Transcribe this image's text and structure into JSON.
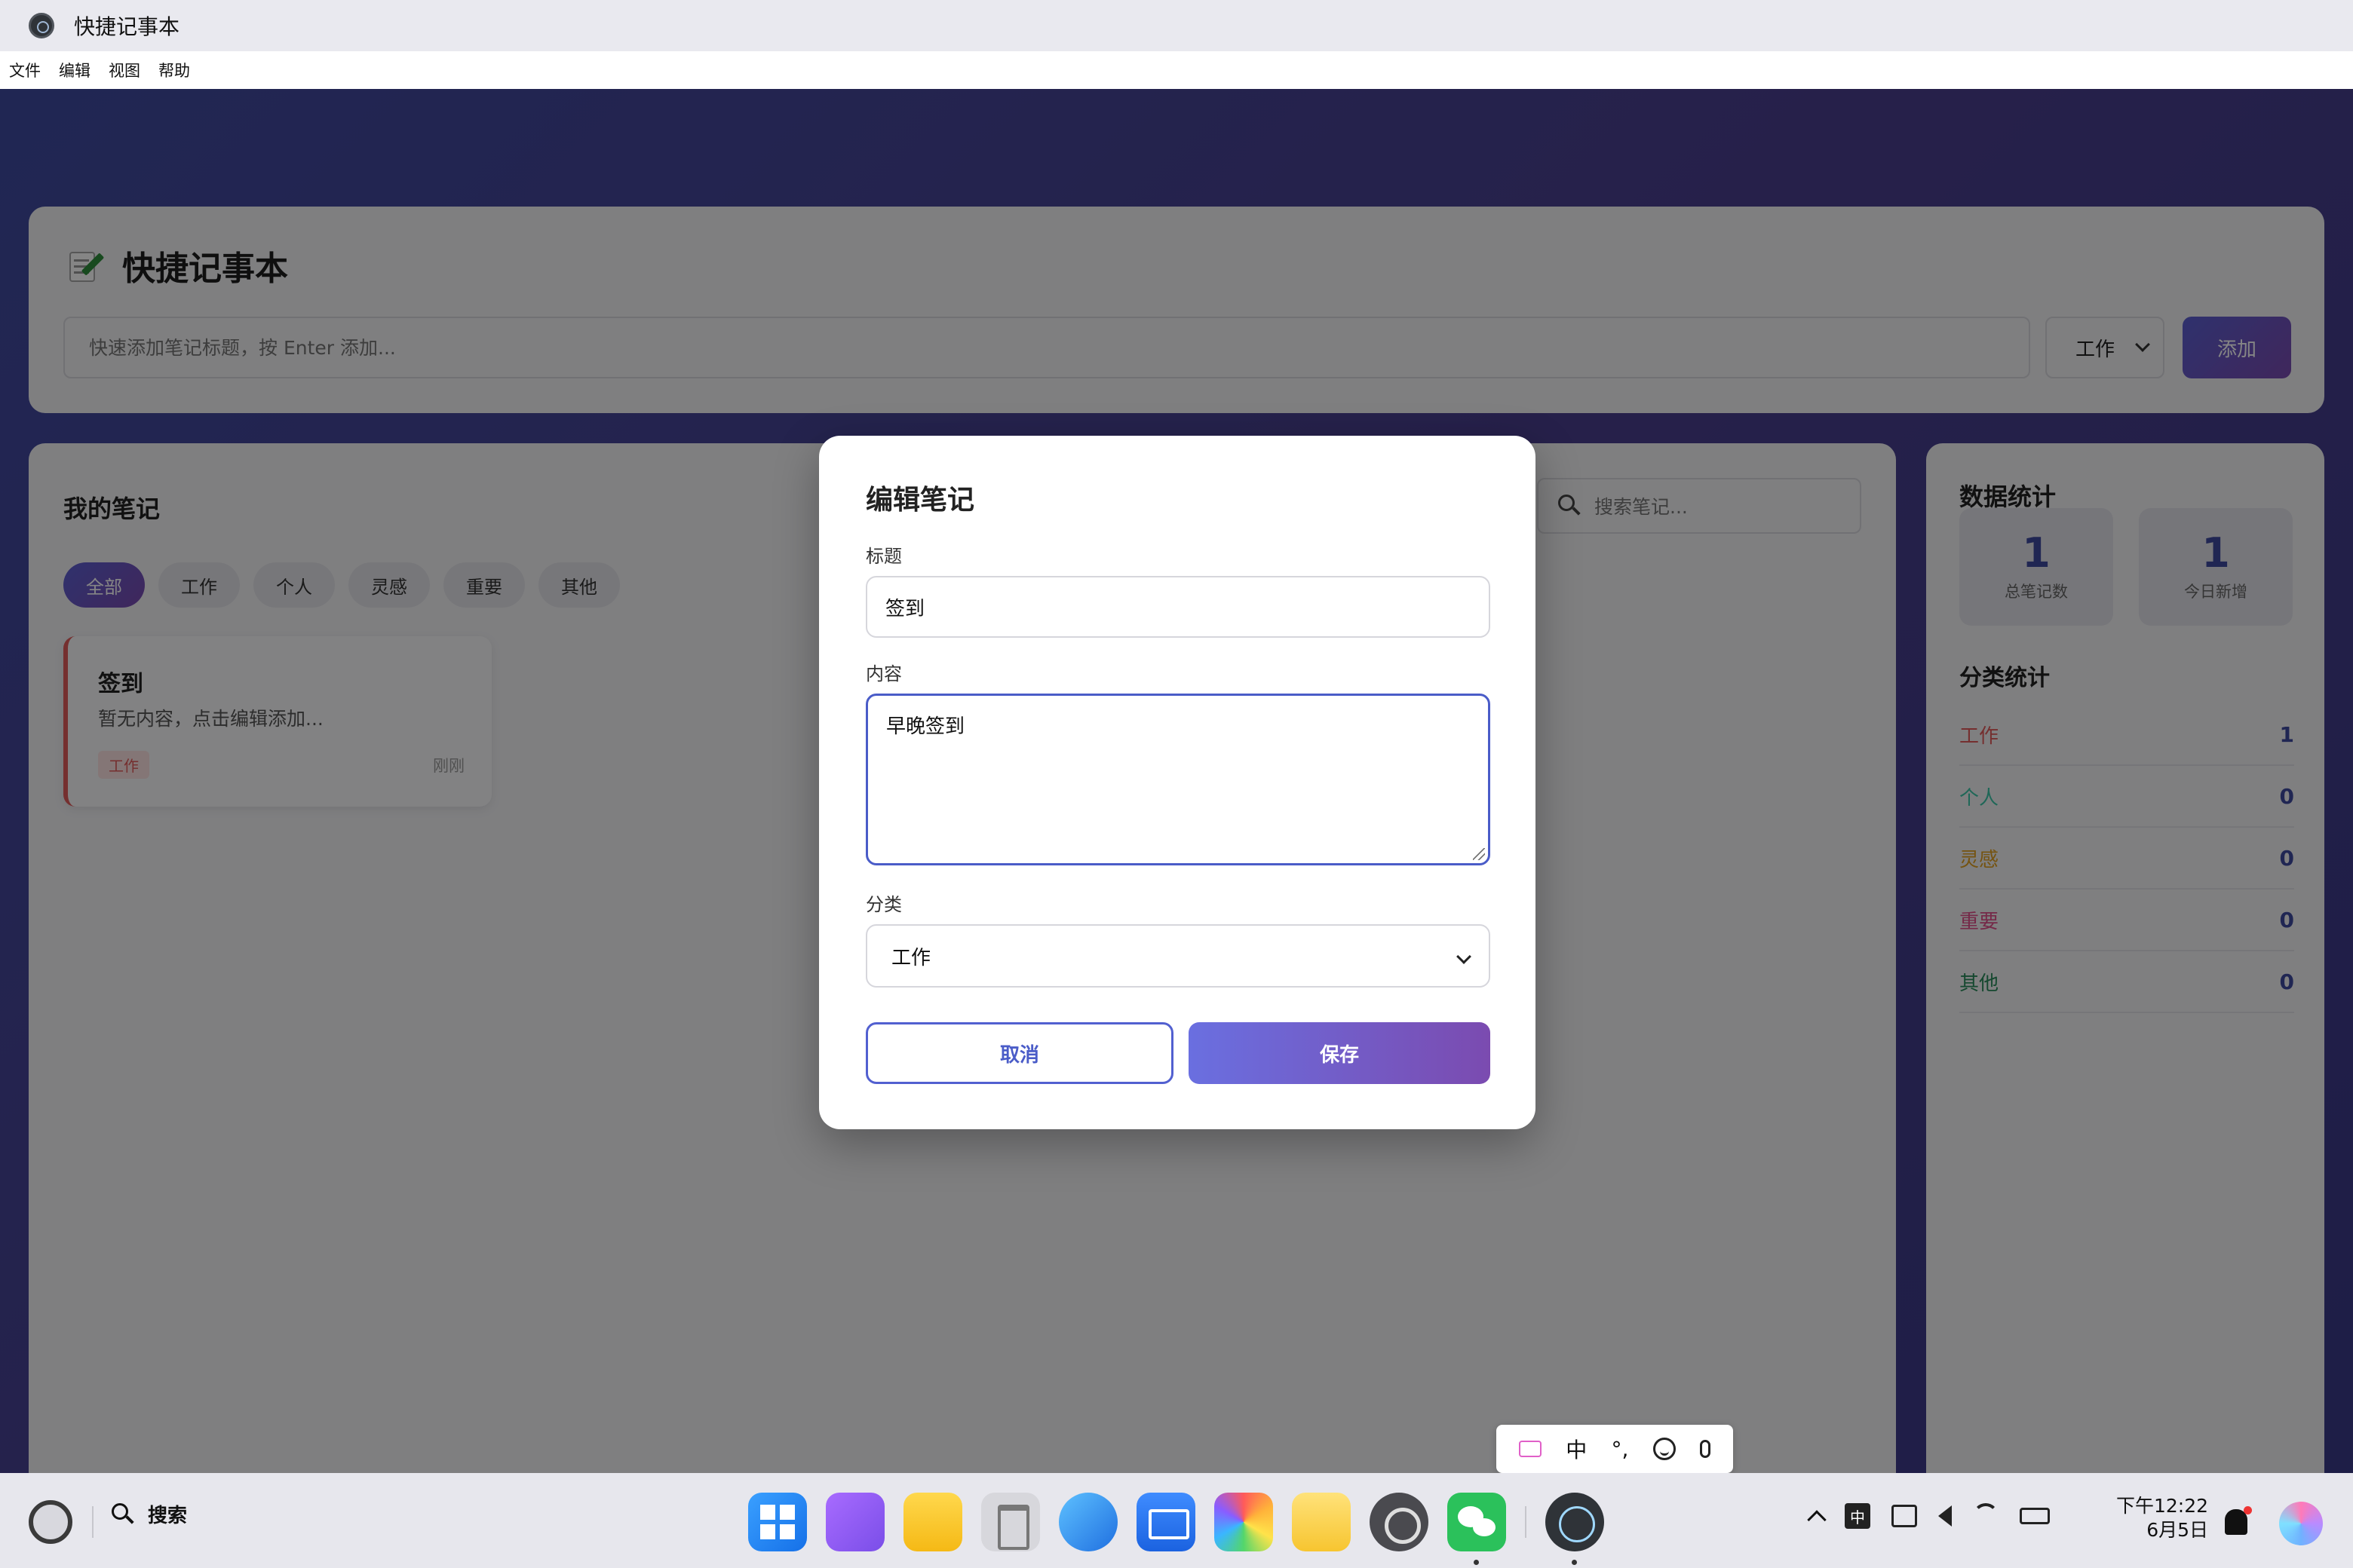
{
  "window": {
    "title": "快捷记事本"
  },
  "menubar": {
    "items": [
      "文件",
      "编辑",
      "视图",
      "帮助"
    ]
  },
  "header": {
    "title": "快捷记事本",
    "quick_add_placeholder": "快速添加笔记标题，按 Enter 添加...",
    "category_selected": "工作",
    "add_label": "添加"
  },
  "notes_panel": {
    "title": "我的笔记",
    "search_placeholder": "搜索笔记...",
    "filters": [
      "全部",
      "工作",
      "个人",
      "灵感",
      "重要",
      "其他"
    ],
    "active_filter": "全部",
    "notes": [
      {
        "title": "签到",
        "body": "暂无内容，点击编辑添加...",
        "tag": "工作",
        "time": "刚刚",
        "color": "#e05a5a"
      }
    ]
  },
  "stats_panel": {
    "title": "数据统计",
    "total": {
      "value": "1",
      "label": "总笔记数"
    },
    "today": {
      "value": "1",
      "label": "今日新增"
    },
    "category_title": "分类统计",
    "categories": [
      {
        "name": "工作",
        "count": "1",
        "color": "#e05a5a"
      },
      {
        "name": "个人",
        "count": "0",
        "color": "#3cc6a8"
      },
      {
        "name": "灵感",
        "count": "0",
        "color": "#e0a020"
      },
      {
        "name": "重要",
        "count": "0",
        "color": "#e0508a"
      },
      {
        "name": "其他",
        "count": "0",
        "color": "#2a8a5a"
      }
    ]
  },
  "modal": {
    "title": "编辑笔记",
    "title_label": "标题",
    "title_value": "签到",
    "content_label": "内容",
    "content_value": "早晚签到",
    "category_label": "分类",
    "category_value": "工作",
    "cancel_label": "取消",
    "save_label": "保存"
  },
  "ime_bar": {
    "lang": "中",
    "punct": "°,"
  },
  "taskbar": {
    "search_label": "搜索",
    "dock_icons": [
      "launcher-icon",
      "multitask-icon",
      "files-icon",
      "trash-icon",
      "browser-icon",
      "mail-icon",
      "photos-icon",
      "notes-icon",
      "settings-icon",
      "wechat-icon",
      "electron-app-icon"
    ],
    "tray_ime": "中",
    "time": "下午12:22",
    "date": "6月5日"
  },
  "colors": {
    "accent": "#5b5fd2",
    "accent_end": "#7b4bb0",
    "bg_gradient": "#3f4aa0"
  }
}
